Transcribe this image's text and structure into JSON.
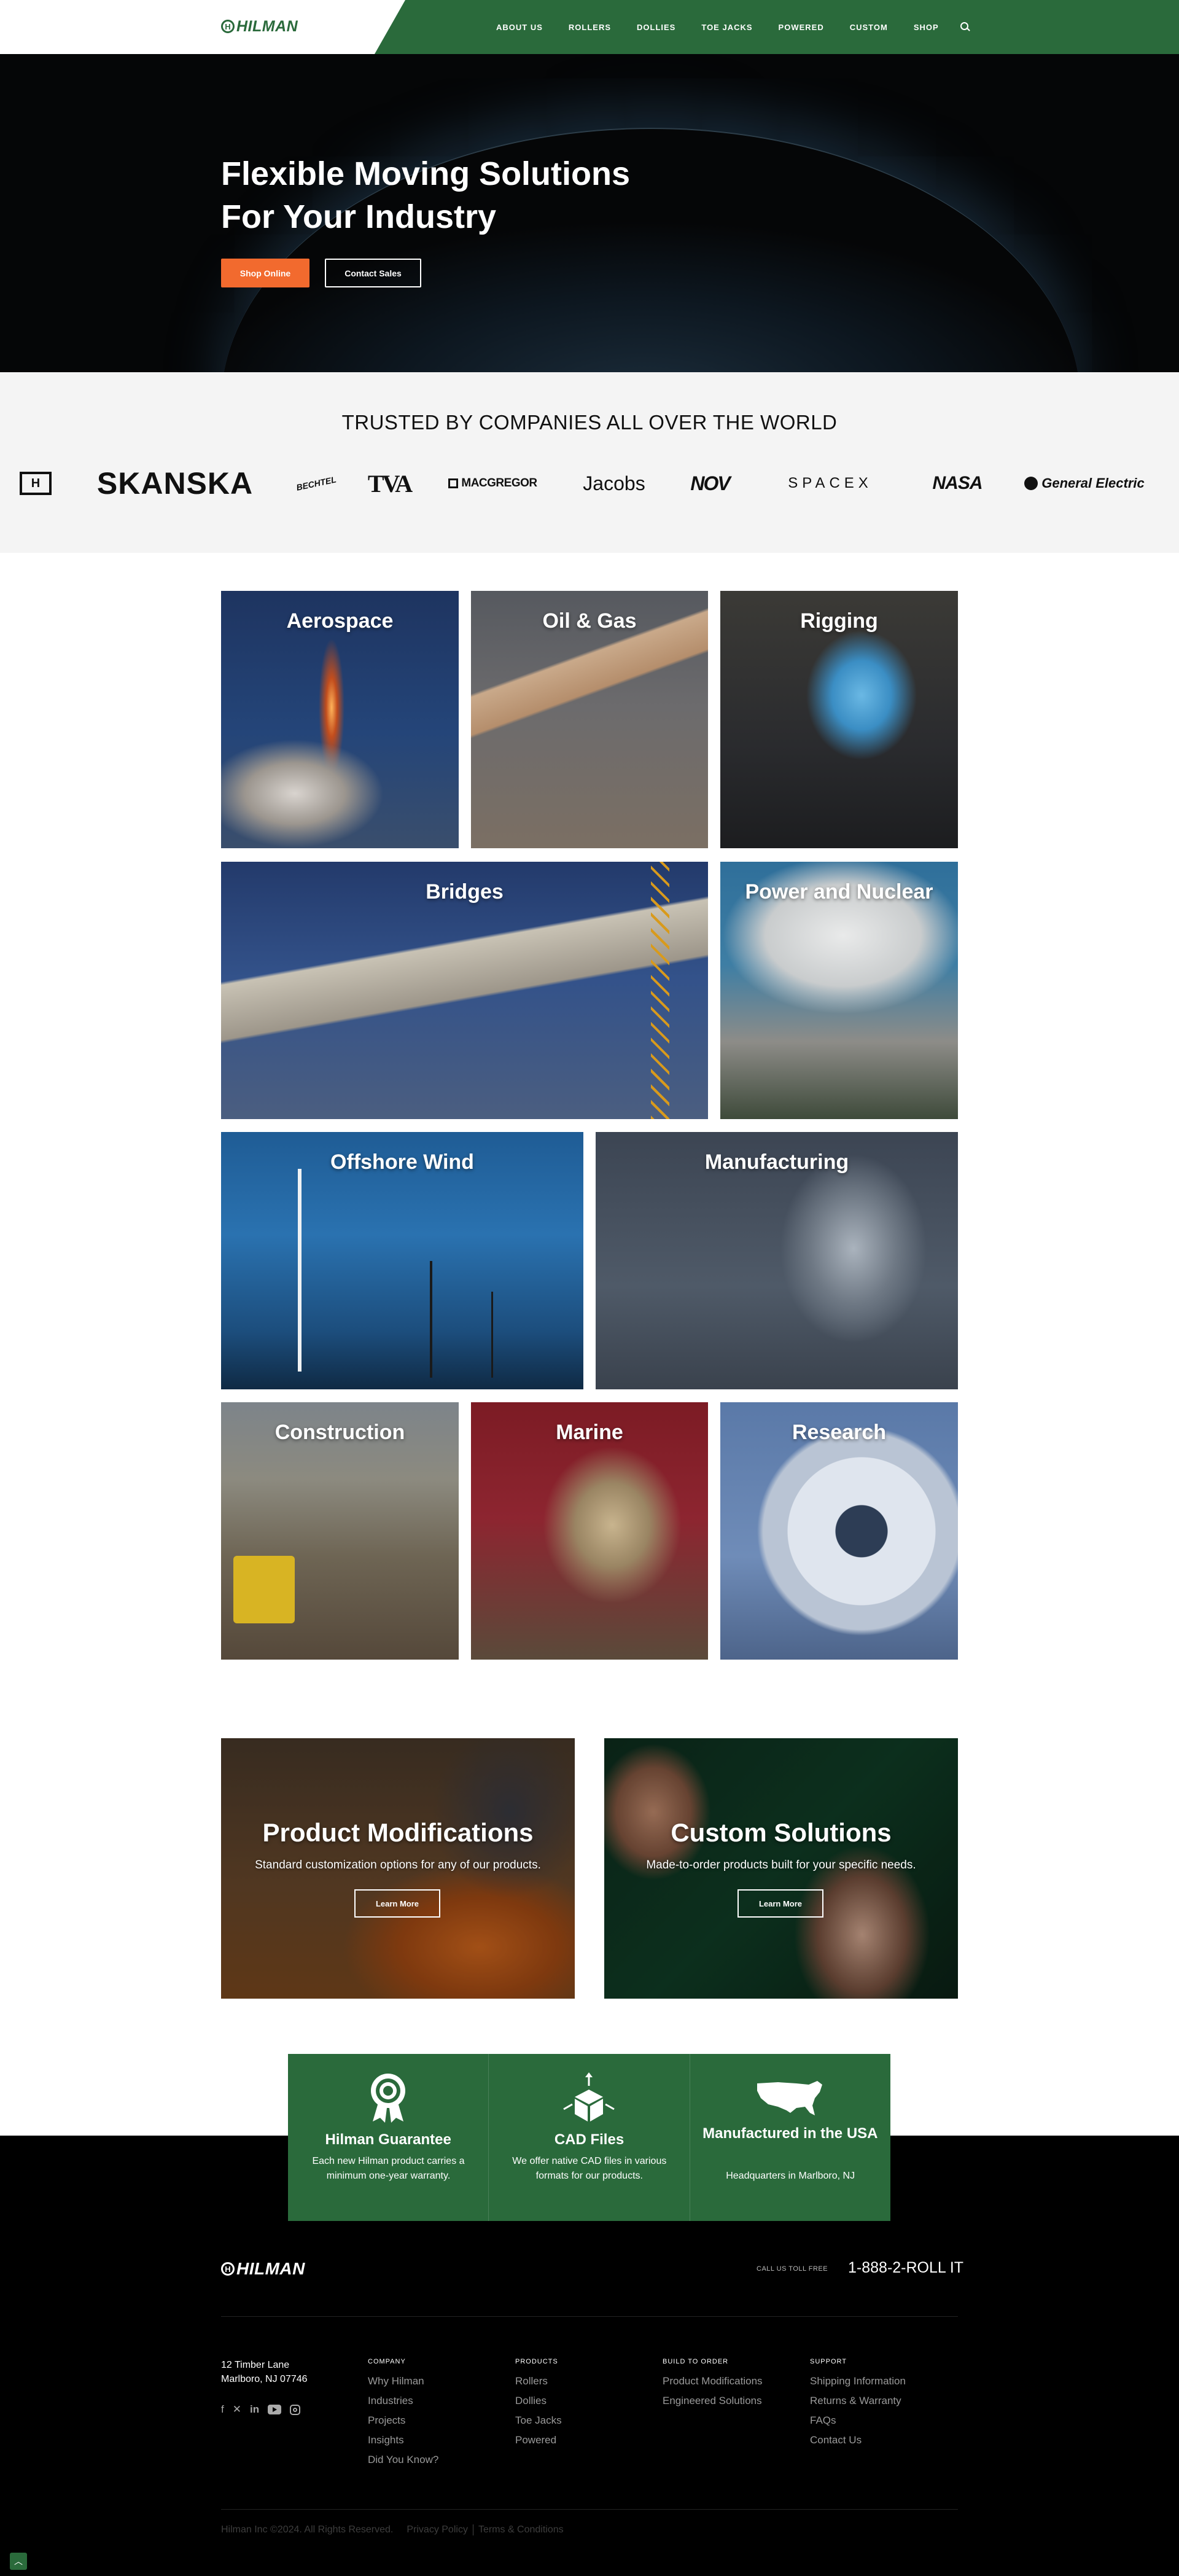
{
  "brand": {
    "name": "HILMAN",
    "mark": "H"
  },
  "nav": {
    "items": [
      "ABOUT US",
      "ROLLERS",
      "DOLLIES",
      "TOE JACKS",
      "POWERED",
      "CUSTOM",
      "SHOP"
    ],
    "search_icon": "search-icon"
  },
  "hero": {
    "title_line1": "Flexible Moving Solutions",
    "title_line2": "For Your Industry",
    "primary_button": "Shop Online",
    "secondary_button": "Contact Sales"
  },
  "trusted": {
    "title": "TRUSTED BY COMPANIES ALL OVER THE WORLD",
    "logos": [
      "H",
      "SKANSKA",
      "BECHTEL",
      "TVA",
      "MACGREGOR",
      "Jacobs",
      "NOV",
      "SPACEX",
      "NASA",
      "General Electric"
    ]
  },
  "industries": [
    "Aerospace",
    "Oil & Gas",
    "Rigging",
    "Bridges",
    "Power and Nuclear",
    "Offshore Wind",
    "Manufacturing",
    "Construction",
    "Marine",
    "Research"
  ],
  "promos": [
    {
      "title": "Product Modifications",
      "subtitle": "Standard customization options for any of our products.",
      "button": "Learn More"
    },
    {
      "title": "Custom Solutions",
      "subtitle": "Made-to-order products built for your specific needs.",
      "button": "Learn More"
    }
  ],
  "features": [
    {
      "title": "Hilman Guarantee",
      "desc": "Each new Hilman product carries a minimum one-year warranty.",
      "icon": "award-ribbon-icon"
    },
    {
      "title": "CAD Files",
      "desc": "We offer native CAD files in various formats for our products.",
      "icon": "cube-download-icon"
    },
    {
      "title": "Manufactured in the USA",
      "desc": "Headquarters in Marlboro, NJ",
      "icon": "usa-map-icon"
    }
  ],
  "footer": {
    "call_label": "CALL US TOLL FREE",
    "phone": "1-888-2-ROLL IT",
    "address_line1": "12 Timber Lane",
    "address_line2": "Marlboro, NJ 07746",
    "social": [
      "facebook-icon",
      "x-icon",
      "linkedin-icon",
      "youtube-icon",
      "instagram-icon"
    ],
    "columns": [
      {
        "heading": "COMPANY",
        "links": [
          "Why Hilman",
          "Industries",
          "Projects",
          "Insights",
          "Did You Know?"
        ]
      },
      {
        "heading": "PRODUCTS",
        "links": [
          "Rollers",
          "Dollies",
          "Toe Jacks",
          "Powered"
        ]
      },
      {
        "heading": "BUILD TO ORDER",
        "links": [
          "Product Modifications",
          "Engineered Solutions"
        ]
      },
      {
        "heading": "SUPPORT",
        "links": [
          "Shipping Information",
          "Returns & Warranty",
          "FAQs",
          "Contact Us"
        ]
      }
    ],
    "copyright": "Hilman Inc ©2024. All Rights Reserved.",
    "privacy": "Privacy Policy",
    "terms": "Terms & Conditions"
  },
  "colors": {
    "brand_green": "#2a6a3b",
    "accent_orange": "#f26a2e",
    "footer_bg": "#000000"
  }
}
